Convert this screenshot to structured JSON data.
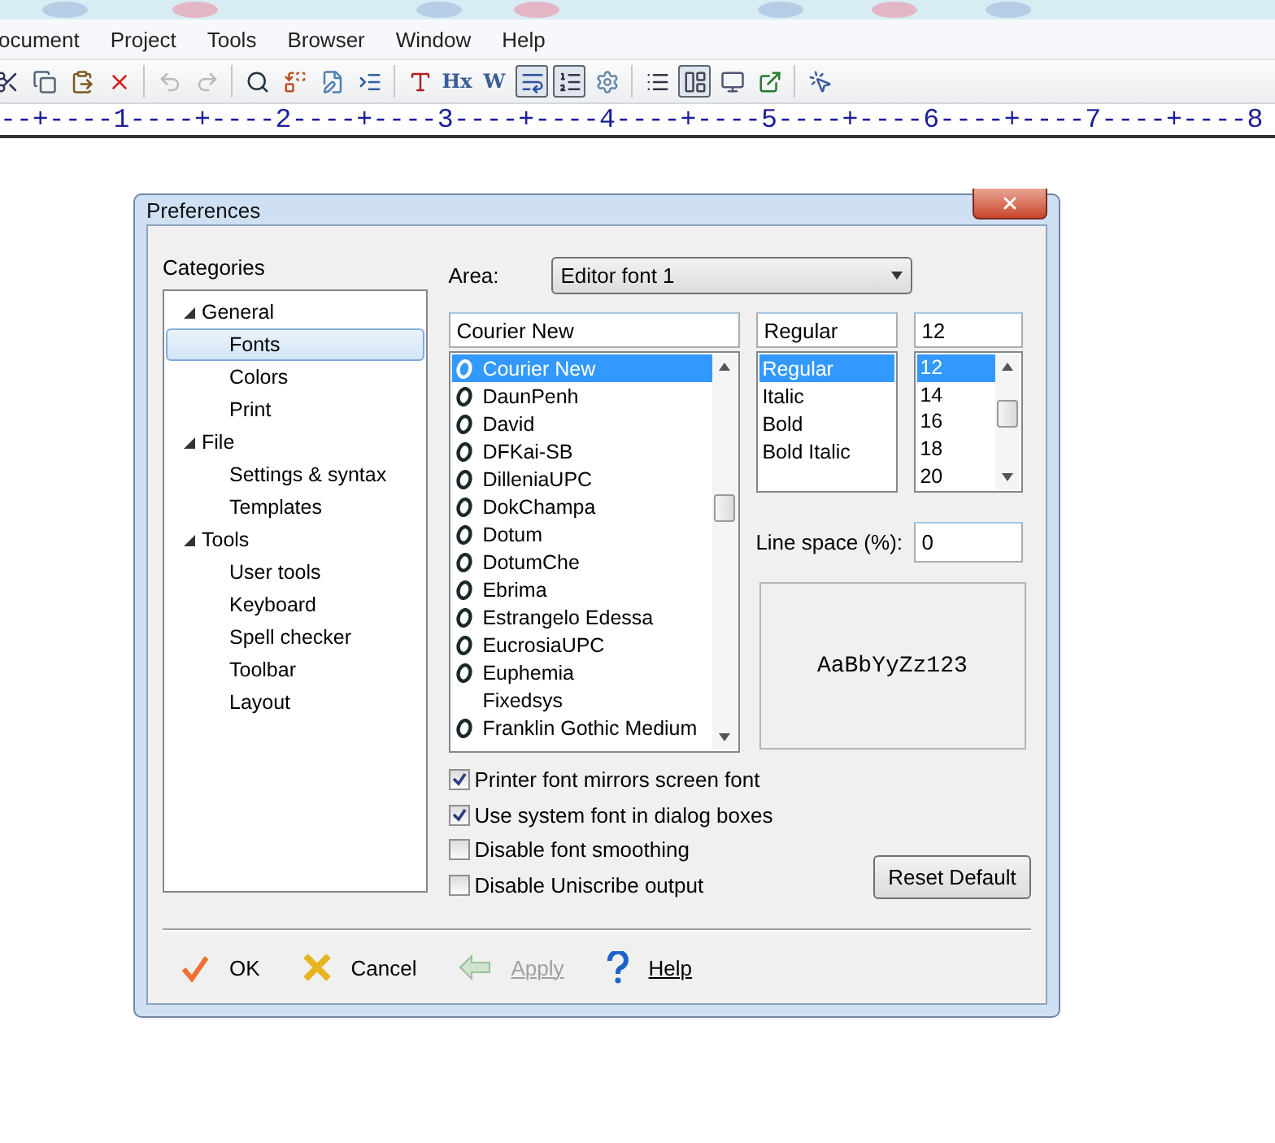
{
  "menu": [
    {
      "label": "ocument"
    },
    {
      "label": "Project"
    },
    {
      "label": "Tools"
    },
    {
      "label": "Browser"
    },
    {
      "label": "Window"
    },
    {
      "label": "Help"
    }
  ],
  "toolbar": [
    {
      "kind": "icon",
      "pressed": false
    },
    {
      "kind": "icon",
      "pressed": false
    },
    {
      "kind": "icon",
      "pressed": false
    },
    {
      "kind": "icon",
      "pressed": false
    },
    {
      "kind": "separator"
    },
    {
      "kind": "icon",
      "pressed": false
    },
    {
      "kind": "icon",
      "pressed": false
    },
    {
      "kind": "separator"
    },
    {
      "kind": "icon",
      "pressed": false
    },
    {
      "kind": "icon",
      "pressed": false
    },
    {
      "kind": "icon",
      "pressed": false
    },
    {
      "kind": "icon",
      "pressed": false
    },
    {
      "kind": "separator"
    },
    {
      "kind": "icon",
      "pressed": false
    },
    {
      "kind": "text",
      "label": "Hx",
      "pressed": false
    },
    {
      "kind": "text",
      "label": "W",
      "pressed": false
    },
    {
      "kind": "icon",
      "pressed": true
    },
    {
      "kind": "icon",
      "pressed": true
    },
    {
      "kind": "icon",
      "pressed": false
    },
    {
      "kind": "separator"
    },
    {
      "kind": "icon",
      "pressed": false
    },
    {
      "kind": "icon",
      "pressed": true
    },
    {
      "kind": "icon",
      "pressed": false
    },
    {
      "kind": "icon",
      "pressed": false
    },
    {
      "kind": "separator"
    },
    {
      "kind": "icon",
      "pressed": false
    }
  ],
  "ruler": "--+----1----+----2----+----3----+----4----+----5----+----6----+----7----+----8",
  "dialog": {
    "title": "Preferences",
    "categories_label": "Categories",
    "categories": [
      {
        "label": "General",
        "expanded": true,
        "selected": false,
        "children": [
          {
            "label": "Fonts",
            "selected": true
          },
          {
            "label": "Colors",
            "selected": false
          },
          {
            "label": "Print",
            "selected": false
          }
        ]
      },
      {
        "label": "File",
        "expanded": true,
        "selected": false,
        "children": [
          {
            "label": "Settings & syntax",
            "selected": false
          },
          {
            "label": "Templates",
            "selected": false
          }
        ]
      },
      {
        "label": "Tools",
        "expanded": true,
        "selected": false,
        "children": [
          {
            "label": "User tools",
            "selected": false
          },
          {
            "label": "Keyboard",
            "selected": false
          },
          {
            "label": "Spell checker",
            "selected": false
          },
          {
            "label": "Toolbar",
            "selected": false
          },
          {
            "label": "Layout",
            "selected": false
          }
        ]
      }
    ],
    "area_label": "Area:",
    "area_value": "Editor font 1",
    "font_value": "Courier New",
    "fonts": [
      {
        "label": "Courier New",
        "kind": "truetype",
        "selected": true
      },
      {
        "label": "DaunPenh",
        "kind": "truetype",
        "selected": false
      },
      {
        "label": "David",
        "kind": "truetype",
        "selected": false
      },
      {
        "label": "DFKai-SB",
        "kind": "truetype",
        "selected": false
      },
      {
        "label": "DilleniaUPC",
        "kind": "truetype",
        "selected": false
      },
      {
        "label": "DokChampa",
        "kind": "truetype",
        "selected": false
      },
      {
        "label": "Dotum",
        "kind": "truetype",
        "selected": false
      },
      {
        "label": "DotumChe",
        "kind": "truetype",
        "selected": false
      },
      {
        "label": "Ebrima",
        "kind": "truetype",
        "selected": false
      },
      {
        "label": "Estrangelo Edessa",
        "kind": "truetype",
        "selected": false
      },
      {
        "label": "EucrosiaUPC",
        "kind": "truetype",
        "selected": false
      },
      {
        "label": "Euphemia",
        "kind": "truetype",
        "selected": false
      },
      {
        "label": "Fixedsys",
        "kind": "raster",
        "selected": false
      },
      {
        "label": "Franklin Gothic Medium",
        "kind": "truetype",
        "selected": false
      }
    ],
    "style_value": "Regular",
    "styles": [
      {
        "label": "Regular",
        "selected": true
      },
      {
        "label": "Italic",
        "selected": false
      },
      {
        "label": "Bold",
        "selected": false
      },
      {
        "label": "Bold Italic",
        "selected": false
      }
    ],
    "size_value": "12",
    "sizes": [
      {
        "label": "12",
        "selected": true
      },
      {
        "label": "14",
        "selected": false
      },
      {
        "label": "16",
        "selected": false
      },
      {
        "label": "18",
        "selected": false
      },
      {
        "label": "20",
        "selected": false
      }
    ],
    "line_space_label": "Line space (%):",
    "line_space_value": "0",
    "preview": "AaBbYyZz123",
    "options": [
      {
        "label": "Printer font mirrors screen font",
        "checked": true
      },
      {
        "label": "Use system font in dialog boxes",
        "checked": true
      },
      {
        "label": "Disable font smoothing",
        "checked": false
      },
      {
        "label": "Disable Uniscribe output",
        "checked": false
      }
    ],
    "reset_button": "Reset Default",
    "buttons": [
      {
        "kind": "ok",
        "label": "OK",
        "disabled": false
      },
      {
        "kind": "cancel",
        "label": "Cancel",
        "disabled": false
      },
      {
        "kind": "apply",
        "label": "Apply",
        "disabled": true
      },
      {
        "kind": "help",
        "label": "Help",
        "disabled": false
      }
    ]
  }
}
